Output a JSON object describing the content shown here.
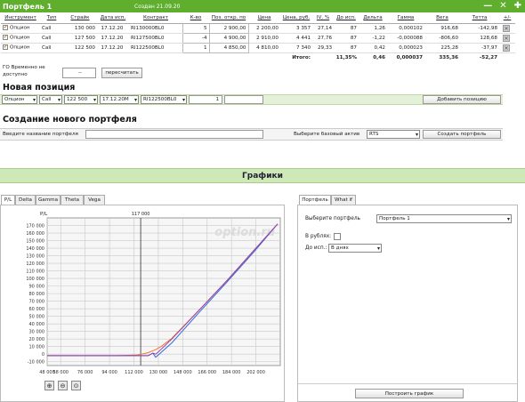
{
  "header": {
    "title": "Портфель 1",
    "created": "Создан 21.09.20",
    "controls": [
      "—",
      "✕",
      "✚"
    ]
  },
  "portfolio": {
    "columns": [
      "Инструмент",
      "Тип",
      "Страйк",
      "Дата исп.",
      "Контракт",
      "К-во",
      "Поз. откр. по",
      "Цена",
      "Цена, руб.",
      "IV, %",
      "До исп.",
      "Дельта",
      "Гамма",
      "Вега",
      "Тетта",
      "+/-"
    ],
    "rows": [
      {
        "instrument": "Опцион",
        "type": "Call",
        "strike": "130 000",
        "date": "17.12.20",
        "contract": "RI130000BL0",
        "qty": "5",
        "open": "2 900,00",
        "price": "2 200,00",
        "price_rub": "3 357",
        "iv": "27,14",
        "days": "87",
        "delta": "1,26",
        "gamma": "0,000102",
        "vega": "916,68",
        "theta": "-142,98"
      },
      {
        "instrument": "Опцион",
        "type": "Call",
        "strike": "127 500",
        "date": "17.12.20",
        "contract": "RI127500BL0",
        "qty": "-4",
        "open": "4 900,00",
        "price": "2 910,00",
        "price_rub": "4 441",
        "iv": "27,76",
        "days": "87",
        "delta": "-1,22",
        "gamma": "-0,000088",
        "vega": "-806,60",
        "theta": "128,68"
      },
      {
        "instrument": "Опцион",
        "type": "Call",
        "strike": "122 500",
        "date": "17.12.20",
        "contract": "RI122500BL0",
        "qty": "1",
        "open": "4 850,00",
        "price": "4 810,00",
        "price_rub": "7 340",
        "iv": "29,33",
        "days": "87",
        "delta": "0,42",
        "gamma": "0,000023",
        "vega": "225,28",
        "theta": "-37,97"
      }
    ],
    "total": {
      "label": "Итого:",
      "pct": "11,35%",
      "delta": "0,46",
      "gamma": "0,000037",
      "vega": "335,36",
      "theta": "-52,27"
    }
  },
  "go": {
    "label": "ГО Временно не доступно",
    "value": "--",
    "recalc_button": "пересчитать"
  },
  "new_position": {
    "heading": "Новая позиция",
    "instrument": "Опцион",
    "type": "Call",
    "strike": "122 500",
    "date": "17.12.20M",
    "contract": "RI122500BL0",
    "qty": "1",
    "add_button": "Добавить позицию"
  },
  "new_portfolio": {
    "heading": "Создание нового портфеля",
    "name_placeholder": "Введите название портфеля",
    "asset_label": "Выберите базовый актив",
    "asset_value": "RTS",
    "create_button": "Создать портфель"
  },
  "graphs": {
    "heading": "Графики",
    "tabs": [
      "P/L",
      "Delta",
      "Gamma",
      "Theta",
      "Vega"
    ],
    "active_tab": "P/L",
    "zoom_icons": [
      "zoom-in-icon",
      "zoom-out-icon",
      "zoom-reset-icon"
    ]
  },
  "right_panel": {
    "tabs": [
      "Портфель",
      "What if"
    ],
    "portfolio_label": "Выберите портфель",
    "portfolio_value": "Портфель 1",
    "rub_label": "В рублях:",
    "days_label": "До исп.:",
    "days_value": "В днях",
    "build_button": "Построить график"
  },
  "chart_data": {
    "type": "line",
    "ylabel": "P/L",
    "watermark": "option.ru",
    "marker_label": "117 000",
    "marker_x": 117000,
    "xlim": [
      48000,
      220000
    ],
    "ylim": [
      -15000,
      180000
    ],
    "x_ticks": [
      "48 000",
      "58 000",
      "76 000",
      "94 000",
      "112 000",
      "130 000",
      "148 000",
      "166 000",
      "184 000",
      "202 000"
    ],
    "x_tick_values": [
      48000,
      58000,
      76000,
      94000,
      112000,
      130000,
      148000,
      166000,
      184000,
      202000
    ],
    "y_ticks": [
      "-10 000",
      "0",
      "10 000",
      "20 000",
      "30 000",
      "40 000",
      "50 000",
      "60 000",
      "70 000",
      "80 000",
      "90 000",
      "100 000",
      "110 000",
      "120 000",
      "130 000",
      "140 000",
      "150 000",
      "160 000",
      "170 000"
    ],
    "y_tick_values": [
      -10000,
      0,
      10000,
      20000,
      30000,
      40000,
      50000,
      60000,
      70000,
      80000,
      90000,
      100000,
      110000,
      120000,
      130000,
      140000,
      150000,
      160000,
      170000
    ],
    "series": [
      {
        "color": "#ee7733",
        "x": [
          48000,
          100000,
          115000,
          122500,
          128000,
          132000,
          140000,
          160000,
          180000,
          200000,
          218000
        ],
        "y": [
          -2000,
          -2000,
          -1000,
          2000,
          6000,
          10000,
          21000,
          58000,
          96000,
          136000,
          172000
        ]
      },
      {
        "color": "#3366dd",
        "x": [
          48000,
          122500,
          126000,
          128000,
          130000,
          140000,
          160000,
          180000,
          200000,
          218000
        ],
        "y": [
          -2000,
          -2000,
          1500,
          -4000,
          -1000,
          15000,
          55000,
          94000,
          134000,
          172000
        ]
      },
      {
        "color": "#9944aa",
        "x": [
          48000,
          122500,
          126000,
          128000,
          130000,
          140000,
          160000,
          180000,
          200000,
          218000
        ],
        "y": [
          -2000,
          -2000,
          1500,
          0,
          3000,
          20000,
          58000,
          96000,
          136000,
          172000
        ]
      }
    ],
    "colors": {
      "grid": "#c8c8c8",
      "plot_bg": "#f6f6f6",
      "marker": "#444444"
    }
  }
}
